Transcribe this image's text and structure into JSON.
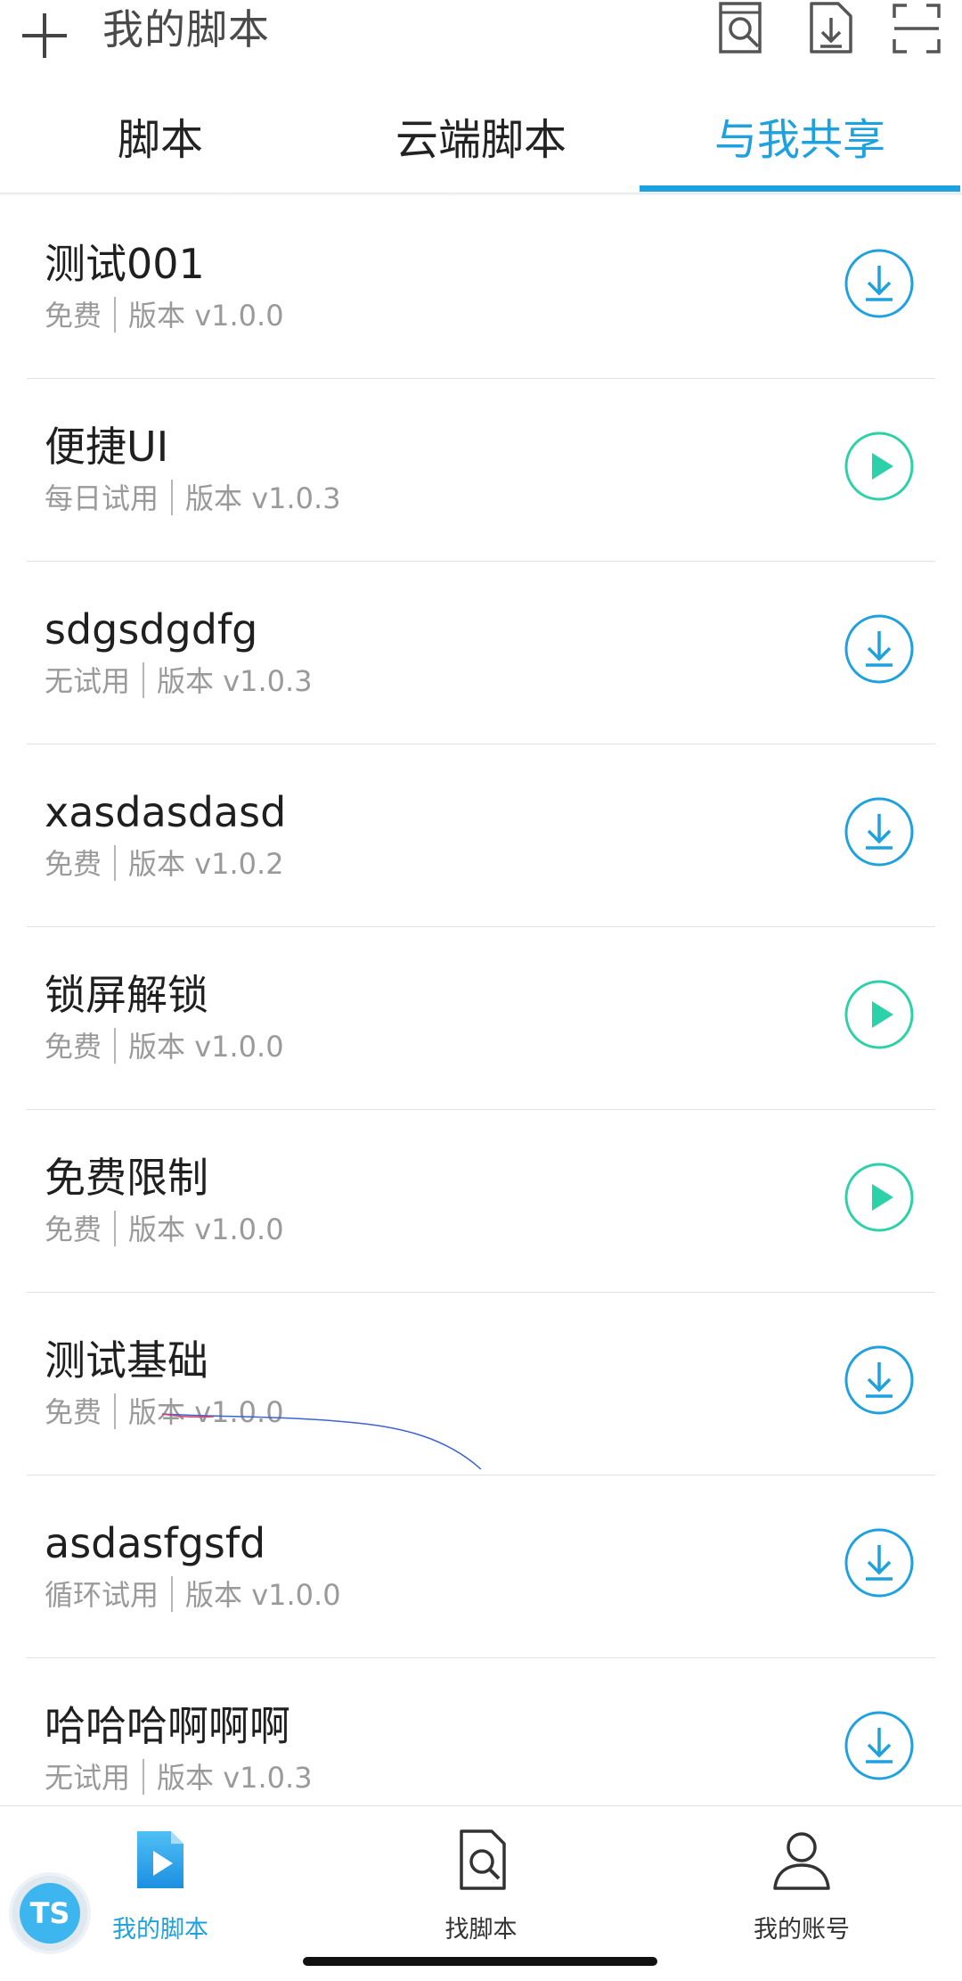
{
  "header": {
    "title": "我的脚本"
  },
  "tabs": [
    {
      "label": "脚本",
      "active": false
    },
    {
      "label": "云端脚本",
      "active": false
    },
    {
      "label": "与我共享",
      "active": true
    }
  ],
  "colors": {
    "accent": "#1ea1df",
    "play": "#2bd1a8",
    "download": "#1ea1df"
  },
  "scripts": [
    {
      "name": "测试001",
      "price": "免费",
      "version": "版本 v1.0.0",
      "action": "download-icon"
    },
    {
      "name": "便捷UI",
      "price": "每日试用",
      "version": "版本 v1.0.3",
      "action": "play-icon"
    },
    {
      "name": "sdgsdgdfg",
      "price": "无试用",
      "version": "版本 v1.0.3",
      "action": "download-icon"
    },
    {
      "name": "xasdasdasd",
      "price": "免费",
      "version": "版本 v1.0.2",
      "action": "download-icon"
    },
    {
      "name": "锁屏解锁",
      "price": "免费",
      "version": "版本 v1.0.0",
      "action": "play-icon"
    },
    {
      "name": "免费限制",
      "price": "免费",
      "version": "版本 v1.0.0",
      "action": "play-icon"
    },
    {
      "name": "测试基础",
      "price": "免费",
      "version": "版本 v1.0.0",
      "action": "download-icon"
    },
    {
      "name": "asdasfgsfd",
      "price": "循环试用",
      "version": "版本 v1.0.0",
      "action": "download-icon"
    },
    {
      "name": "哈哈哈啊啊啊",
      "price": "无试用",
      "version": "版本 v1.0.3",
      "action": "download-icon"
    }
  ],
  "bottom_nav": [
    {
      "label": "我的脚本",
      "icon": "script-play-icon",
      "active": true
    },
    {
      "label": "找脚本",
      "icon": "find-script-icon",
      "active": false
    },
    {
      "label": "我的账号",
      "icon": "user-icon",
      "active": false
    }
  ],
  "badge": {
    "text": "TS"
  }
}
